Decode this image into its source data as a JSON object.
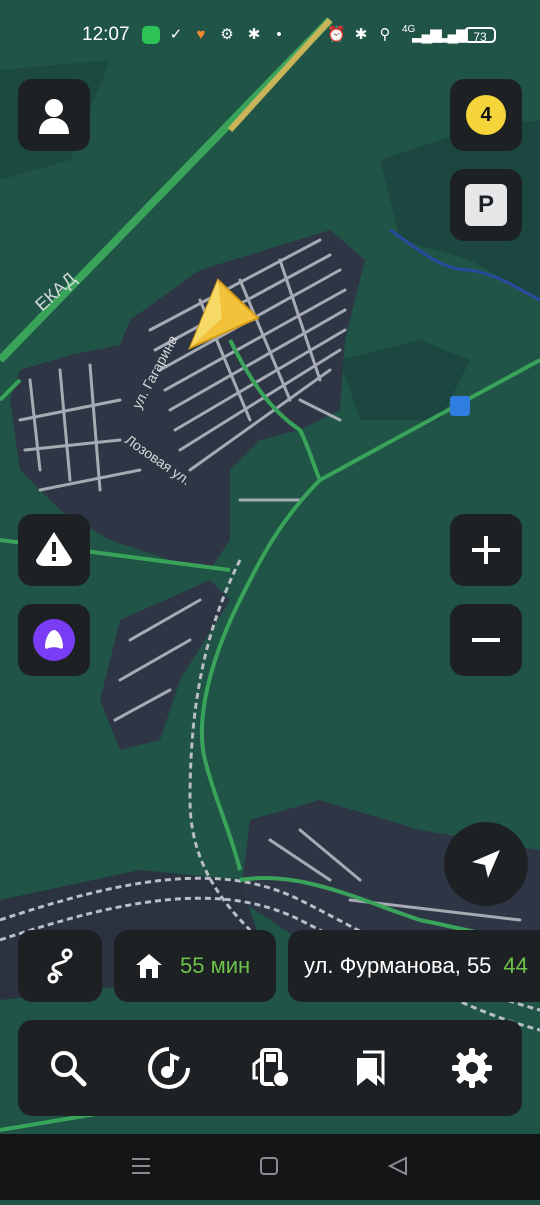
{
  "status_bar": {
    "time": "12:07",
    "network": "4G",
    "battery": "73"
  },
  "map": {
    "road_labels": [
      "ЕКАД",
      "ул. Гагарина",
      "Лозовая ул."
    ],
    "colors": {
      "background": "#1f5446",
      "urban": "#2e3646",
      "roads": "#a6aab3",
      "traffic_green": "#3aa35a",
      "highway_yellow": "#c9b45a"
    }
  },
  "controls": {
    "traffic_level": "4",
    "parking_label": "P"
  },
  "route_info": {
    "eta": "55 мин",
    "destination": "ул. Фурманова, 55",
    "distance_partial": "44"
  },
  "bottom_bar": {
    "icons": [
      "search-icon",
      "music-icon",
      "fuel-icon",
      "bookmarks-icon",
      "settings-icon"
    ]
  }
}
